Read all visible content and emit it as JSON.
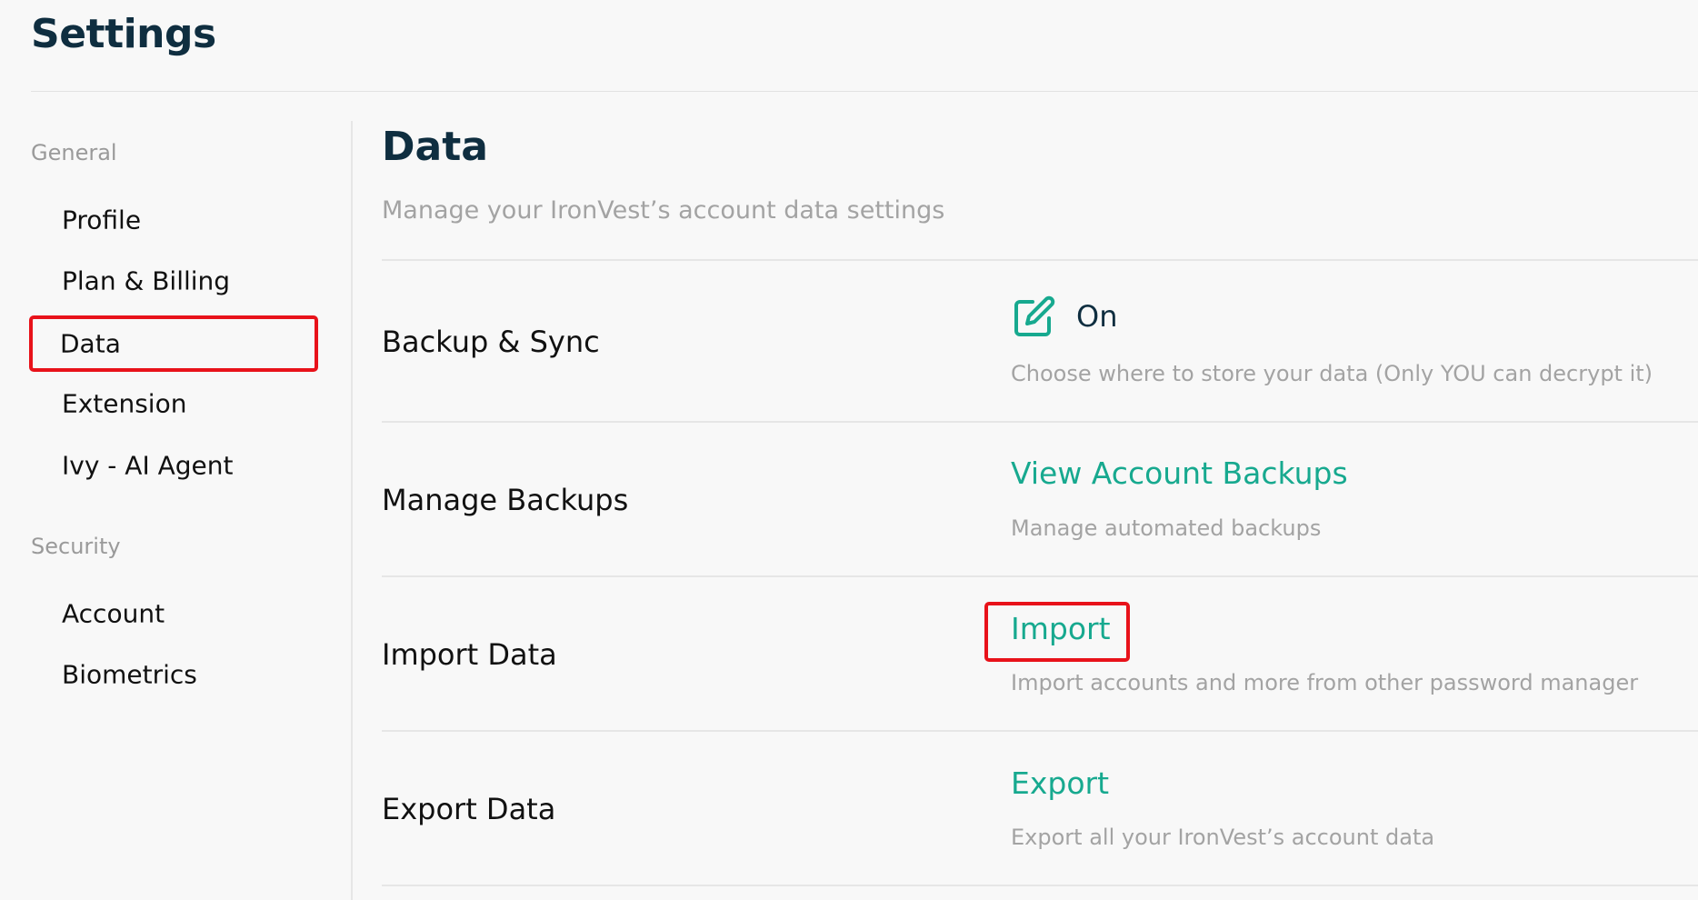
{
  "header": {
    "title": "Settings"
  },
  "sidebar": {
    "sections": [
      {
        "label": "General",
        "items": [
          {
            "label": "Profile"
          },
          {
            "label": "Plan & Billing"
          },
          {
            "label": "Data",
            "active": true
          },
          {
            "label": "Extension"
          },
          {
            "label": "Ivy - AI Agent"
          }
        ]
      },
      {
        "label": "Security",
        "items": [
          {
            "label": "Account"
          },
          {
            "label": "Biometrics"
          }
        ]
      }
    ]
  },
  "main": {
    "title": "Data",
    "subtitle": "Manage your IronVest’s account data settings",
    "rows": [
      {
        "label": "Backup & Sync",
        "icon": "edit-icon",
        "status": "On",
        "description": "Choose where to store your data (Only YOU can decrypt it)"
      },
      {
        "label": "Manage Backups",
        "action": "View Account Backups",
        "description": "Manage automated backups"
      },
      {
        "label": "Import Data",
        "action": "Import",
        "description": "Import accounts and more from other password manager"
      },
      {
        "label": "Export Data",
        "action": "Export",
        "description": "Export all your IronVest’s account data"
      }
    ]
  },
  "colors": {
    "heading": "#0f2e40",
    "accent": "#17a98f",
    "muted": "#a3a3a3",
    "highlight": "#e8121a",
    "background": "#f8f8f8"
  }
}
